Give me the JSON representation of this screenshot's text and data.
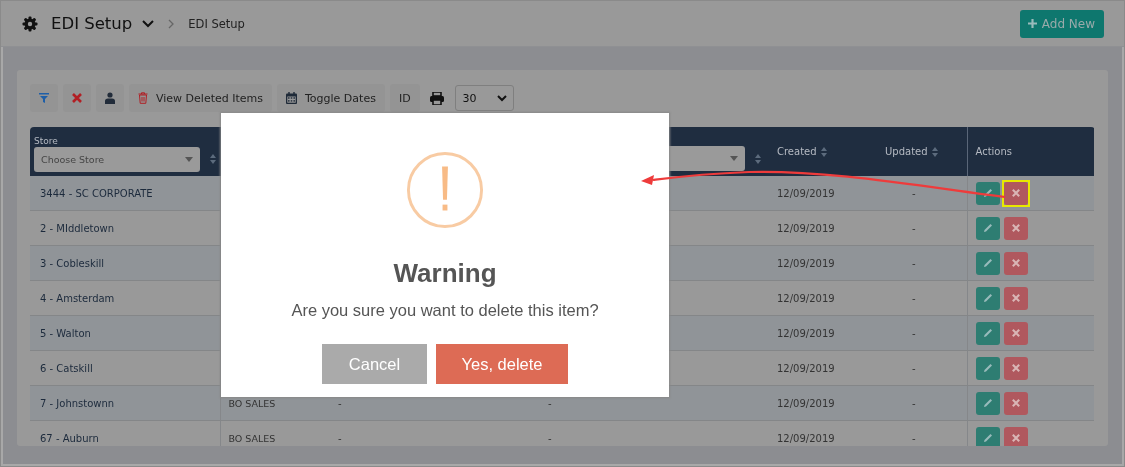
{
  "header": {
    "title": "EDI Setup",
    "breadcrumb": "EDI Setup",
    "add_button": "Add New"
  },
  "toolbar": {
    "buttons": [
      {
        "kind": "filter"
      },
      {
        "kind": "clear"
      },
      {
        "kind": "user"
      },
      {
        "kind": "deleted",
        "label": "View Deleted Items"
      },
      {
        "kind": "dates",
        "label": "Toggle Dates"
      },
      {
        "kind": "plain",
        "label": "ID"
      }
    ],
    "page_size": "30"
  },
  "table": {
    "store_label": "Store",
    "store_placeholder": "Choose Store",
    "created_label": "Created",
    "updated_label": "Updated",
    "actions_label": "Actions",
    "rows": [
      {
        "store": "3444 - SC CORPORATE",
        "created": "12/09/2019",
        "updated": "-",
        "delete_highlighted": true
      },
      {
        "store": "2 - MIddletown",
        "created": "12/09/2019",
        "updated": "-",
        "delete_highlighted": false
      },
      {
        "store": "3 - Cobleskill",
        "created": "12/09/2019",
        "updated": "-",
        "delete_highlighted": false
      },
      {
        "store": "4 - Amsterdam",
        "created": "12/09/2019",
        "updated": "-",
        "delete_highlighted": false
      },
      {
        "store": "5 - Walton",
        "created": "12/09/2019",
        "updated": "-",
        "delete_highlighted": false
      },
      {
        "store": "6 - Catskill",
        "created": "12/09/2019",
        "updated": "-",
        "delete_highlighted": false
      },
      {
        "store": "7 - Johnstownn",
        "column_2": "BO SALES",
        "column_3": "-",
        "column_4": "-",
        "created": "12/09/2019",
        "updated": "-",
        "delete_highlighted": false
      },
      {
        "store": "67 - Auburn",
        "column_2": "BO SALES",
        "column_3": "-",
        "column_4": "-",
        "created": "12/09/2019",
        "updated": "-",
        "delete_highlighted": false
      }
    ]
  },
  "dialog": {
    "title": "Warning",
    "message": "Are you sure you want to delete this item?",
    "buttons": [
      {
        "kind": "cancel",
        "label": "Cancel"
      },
      {
        "kind": "confirm",
        "label": "Yes, delete"
      }
    ]
  }
}
